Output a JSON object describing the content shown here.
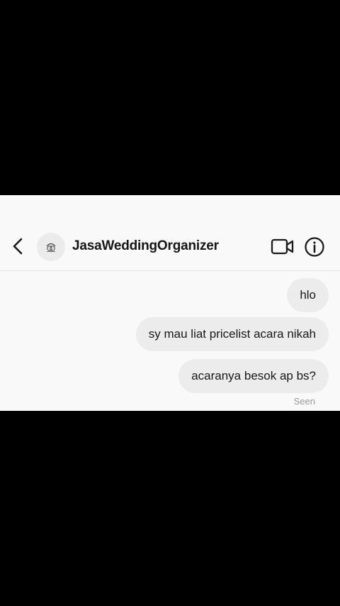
{
  "header": {
    "back_icon": "chevron-left-icon",
    "contact_name": "JasaWeddingOrganizer",
    "avatar_icon": "ring-logo-icon",
    "video_icon": "video-camera-icon",
    "info_icon": "info-circle-icon"
  },
  "messages": [
    {
      "text": "hlo",
      "sender": "me"
    },
    {
      "text": "sy mau liat pricelist acara nikah",
      "sender": "me"
    },
    {
      "text": "acaranya besok ap bs?",
      "sender": "me"
    }
  ],
  "status": {
    "seen_label": "Seen"
  },
  "colors": {
    "background": "#000000",
    "screen": "#f9f9f9",
    "bubble": "#ececec"
  }
}
